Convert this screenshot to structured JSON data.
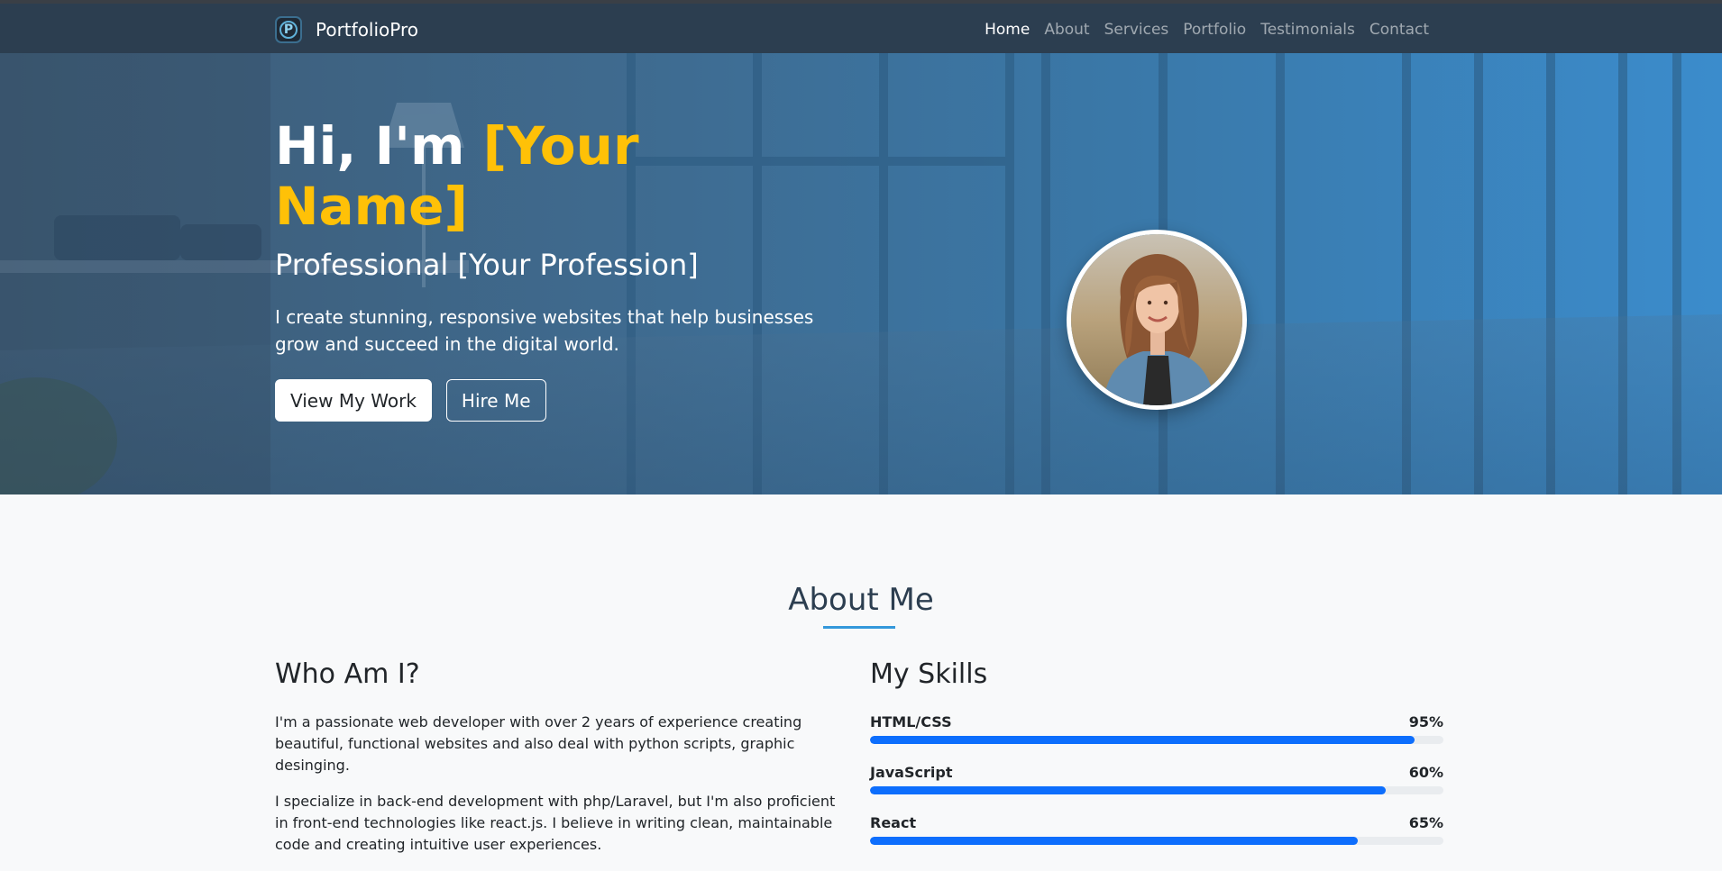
{
  "navbar": {
    "brand": "PortfolioPro",
    "links": [
      {
        "label": "Home",
        "active": true
      },
      {
        "label": "About"
      },
      {
        "label": "Services"
      },
      {
        "label": "Portfolio"
      },
      {
        "label": "Testimonials"
      },
      {
        "label": "Contact"
      }
    ]
  },
  "hero": {
    "title_prefix": "Hi, I'm ",
    "title_highlight": "[Your Name]",
    "subtitle": "Professional [Your Profession]",
    "description": "I create stunning, responsive websites that help businesses grow and succeed in the digital world.",
    "primary_button": "View My Work",
    "secondary_button": "Hire Me"
  },
  "about": {
    "title": "About Me",
    "who": {
      "heading": "Who Am I?",
      "paragraphs": [
        "I'm a passionate web developer with over 2 years of experience creating beautiful, functional websites and also deal with python scripts, graphic desinging.",
        "I specialize in back-end development with php/Laravel, but I'm also proficient in front-end technologies like react.js. I believe in writing clean, maintainable code and creating intuitive user experiences."
      ]
    },
    "skills": {
      "heading": "My Skills",
      "items": [
        {
          "name": "HTML/CSS",
          "percent_label": "95%",
          "fill": 0.95
        },
        {
          "name": "JavaScript",
          "percent_label": "60%",
          "fill": 0.9
        },
        {
          "name": "React",
          "percent_label": "65%",
          "fill": 0.85
        }
      ]
    }
  },
  "colors": {
    "navbar": "#2c3e50",
    "highlight": "#ffc107",
    "accent": "#3498db",
    "progress": "#0d6efd"
  },
  "icons": {
    "logo": "portfoliopro-logo-icon",
    "avatar": "profile-photo"
  }
}
